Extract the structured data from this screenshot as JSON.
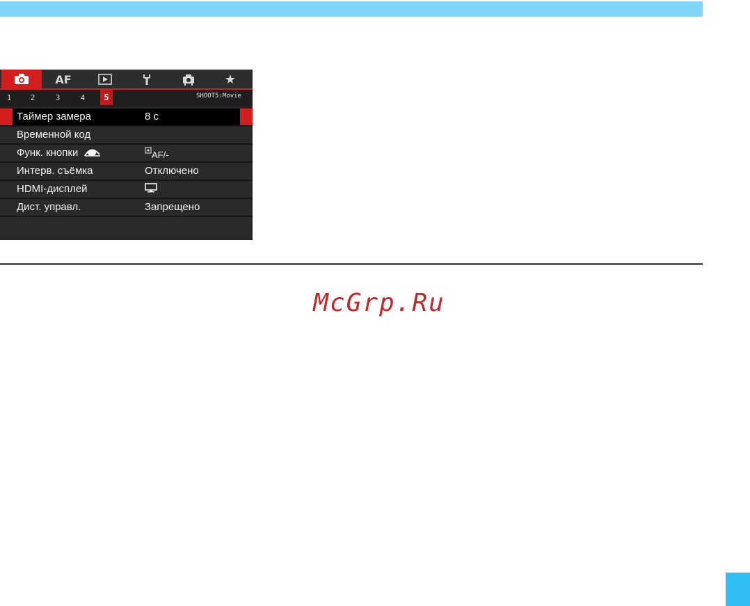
{
  "colors": {
    "top_bar": "#7fd6fb",
    "accent_red": "#d41e1e",
    "menu_bg": "#262626",
    "watermark": "#c0282a",
    "corner_tab": "#30bff5"
  },
  "camera_menu": {
    "main_tabs": [
      {
        "icon": "camera-icon",
        "active": true
      },
      {
        "label": "AF"
      },
      {
        "icon": "playback-icon"
      },
      {
        "icon": "wrench-icon"
      },
      {
        "icon": "custom-functions-icon"
      },
      {
        "icon": "star-icon"
      }
    ],
    "sub_tabs": [
      "1",
      "2",
      "3",
      "4",
      "5"
    ],
    "active_sub_tab": "5",
    "section_label": "SHOOT5:Movie",
    "rows": [
      {
        "label": "Таймер замера",
        "value": "8 с",
        "selected": true
      },
      {
        "label": "Временной код",
        "value": ""
      },
      {
        "label": "Функ. кнопки",
        "label_icon": "eye-icon",
        "value": "AF/-",
        "value_icon": "af-frame-icon"
      },
      {
        "label": "Интерв. съёмка",
        "value": "Отключено"
      },
      {
        "label": "HDMI-дисплей",
        "value_icon": "screen-icon"
      },
      {
        "label": "Дист. управл.",
        "value": "Запрещено"
      }
    ]
  },
  "watermark": "McGrp.Ru"
}
